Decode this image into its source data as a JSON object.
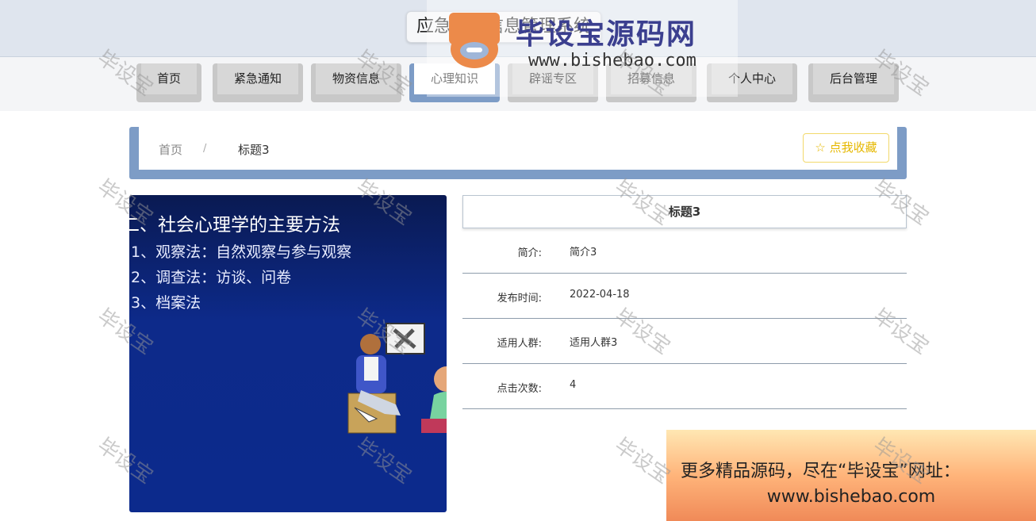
{
  "app": {
    "title": "应急互助信息管理系统"
  },
  "nav": {
    "items": [
      {
        "label": "首页"
      },
      {
        "label": "紧急通知"
      },
      {
        "label": "物资信息"
      },
      {
        "label": "心理知识"
      },
      {
        "label": "辟谣专区"
      },
      {
        "label": "招募信息"
      },
      {
        "label": "个人中心"
      },
      {
        "label": "后台管理"
      }
    ],
    "active_index": 3
  },
  "breadcrumb": {
    "home": "首页",
    "separator": "/",
    "current": "标题3"
  },
  "favorite": {
    "label": "☆ 点我收藏"
  },
  "slide": {
    "title": "二、社会心理学的主要方法",
    "lines": [
      "1、观察法：自然观察与参与观察",
      "2、调查法：访谈、问卷",
      "3、档案法"
    ]
  },
  "detail": {
    "title": "标题3",
    "rows": [
      {
        "label": "简介:",
        "value": "简介3"
      },
      {
        "label": "发布时间:",
        "value": "2022-04-18"
      },
      {
        "label": "适用人群:",
        "value": "适用人群3"
      },
      {
        "label": "点击次数:",
        "value": "4"
      }
    ]
  },
  "watermark": {
    "text": "毕设宝",
    "logo_text": "毕设宝源码网",
    "logo_url": "www.bishebao.com"
  },
  "promo": {
    "line1": "更多精品源码，尽在“毕设宝”网址：",
    "line2": "www.bishebao.com"
  },
  "colors": {
    "accent": "#7d9cc6",
    "favorite": "#e6b800",
    "header_bg": "#dfe5ee"
  }
}
